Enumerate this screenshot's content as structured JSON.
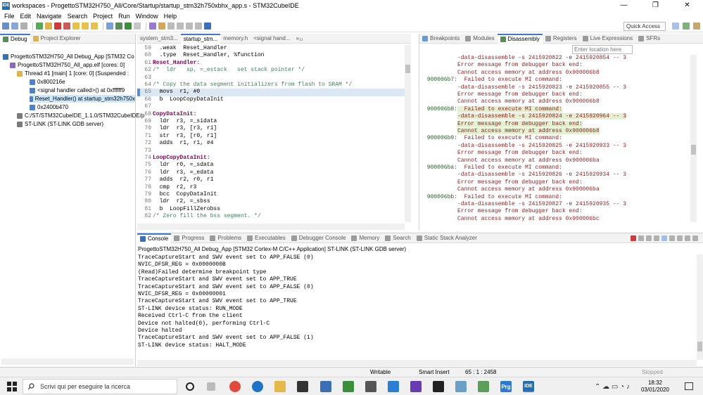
{
  "window": {
    "title": "workspaces - ProgettoSTM32H750_All/Core/Startup/startup_stm32h750xbhx_app.s - STM32CubeIDE",
    "app_icon": "IDE",
    "min": "—",
    "max": "❐",
    "close": "✕"
  },
  "menu": [
    "File",
    "Edit",
    "Navigate",
    "Search",
    "Project",
    "Run",
    "Window",
    "Help"
  ],
  "quick_access": "Quick Access",
  "left_tabs": [
    "Debug",
    "Project Explorer"
  ],
  "debug_tree": [
    "ProgettoSTM32H750_All Debug_App [STM32 Co",
    "ProgettoSTM32H750_All_app.elf [cores: 0]",
    "Thread #1 [main] 1 [core: 0] (Suspended :",
    "0x800216e",
    "<signal handler called>() at 0xffffff9",
    "Reset_Handler() at startup_stm32h750x",
    "0x2400b470",
    "C:/ST/STM32CubeIDE_1.1.0/STM32CubeIDE/p",
    "ST-LINK (ST-LINK GDB server)"
  ],
  "editor_tabs": [
    "system_stm3...",
    "startup_stm...",
    "memory.h",
    "<signal hand...",
    "»₂₁"
  ],
  "code": [
    {
      "n": "59",
      "t": "  .weak  Reset_Handler"
    },
    {
      "n": "60",
      "t": "  .type  Reset_Handler, %function"
    },
    {
      "n": "61",
      "t": "Reset_Handler:"
    },
    {
      "n": "62",
      "t": "/*  ldr   sp, =_estack   set stack pointer */"
    },
    {
      "n": "63",
      "t": ""
    },
    {
      "n": "64",
      "t": "/* Copy the data segment initializers from flash to SRAM */"
    },
    {
      "n": "65",
      "t": "  movs  r1, #0"
    },
    {
      "n": "66",
      "t": "  b  LoopCopyDataInit"
    },
    {
      "n": "67",
      "t": ""
    },
    {
      "n": "68",
      "t": "CopyDataInit:"
    },
    {
      "n": "69",
      "t": "  ldr  r3, =_sidata"
    },
    {
      "n": "70",
      "t": "  ldr  r3, [r3, r1]"
    },
    {
      "n": "71",
      "t": "  str  r3, [r0, r1]"
    },
    {
      "n": "72",
      "t": "  adds  r1, r1, #4"
    },
    {
      "n": "73",
      "t": ""
    },
    {
      "n": "74",
      "t": "LoopCopyDataInit:"
    },
    {
      "n": "75",
      "t": "  ldr  r0, =_sdata"
    },
    {
      "n": "76",
      "t": "  ldr  r3, =_edata"
    },
    {
      "n": "77",
      "t": "  adds  r2, r0, r1"
    },
    {
      "n": "78",
      "t": "  cmp  r2, r3"
    },
    {
      "n": "79",
      "t": "  bcc  CopyDataInit"
    },
    {
      "n": "80",
      "t": "  ldr  r2, =_sbss"
    },
    {
      "n": "81",
      "t": "  b  LoopFillZerobss"
    },
    {
      "n": "82",
      "t": "/* Zero fill the bss segment. */"
    }
  ],
  "right_tabs": [
    "Breakpoints",
    "Modules",
    "Disassembly",
    "Registers",
    "Live Expressions",
    "SFRs"
  ],
  "location_placeholder": "Enter location here",
  "disasm": [
    {
      "a": "",
      "t": "-data-disassemble -s 2415920822 -e 2415920854 -- 3"
    },
    {
      "a": "",
      "t": "Error message from debugger back end:"
    },
    {
      "a": "",
      "t": "Cannot access memory at address 0x900006b8"
    },
    {
      "a": "900006b7:",
      "t": "  Failed to execute MI command:"
    },
    {
      "a": "",
      "t": "-data-disassemble -s 2415920823 -e 2415920855 -- 3"
    },
    {
      "a": "",
      "t": "Error message from debugger back end:"
    },
    {
      "a": "",
      "t": "Cannot access memory at address 0x900006b8"
    },
    {
      "a": "900006b8:",
      "t": "  Failed to execute MI command:"
    },
    {
      "a": "",
      "t": "-data-disassemble -s 2415920824 -e 2415920964 -- 3"
    },
    {
      "a": "",
      "t": "Error message from debugger back end:"
    },
    {
      "a": "",
      "t": "Cannot access memory at address 0x900006b8"
    },
    {
      "a": "900006b9:",
      "t": "  Failed to execute MI command:"
    },
    {
      "a": "",
      "t": "-data-disassemble -s 2415920825 -e 2415920933 -- 3"
    },
    {
      "a": "",
      "t": "Error message from debugger back end:"
    },
    {
      "a": "",
      "t": "Cannot access memory at address 0x900006ba"
    },
    {
      "a": "900006ba:",
      "t": "  Failed to execute MI command:"
    },
    {
      "a": "",
      "t": "-data-disassemble -s 2415920826 -e 2415920934 -- 3"
    },
    {
      "a": "",
      "t": "Error message from debugger back end:"
    },
    {
      "a": "",
      "t": "Cannot access memory at address 0x900006ba"
    },
    {
      "a": "900006bb:",
      "t": "  Failed to execute MI command:"
    },
    {
      "a": "",
      "t": "-data-disassemble -s 2415920827 -e 2415920935 -- 3"
    },
    {
      "a": "",
      "t": "Error message from debugger back end:"
    },
    {
      "a": "",
      "t": "Cannot access memory at address 0x900006bc"
    }
  ],
  "console_tabs": [
    "Console",
    "Progress",
    "Problems",
    "Executables",
    "Debugger Console",
    "Memory",
    "Search",
    "Static Stack Analyzer"
  ],
  "console_header": "ProgettoSTM32H750_All Debug_App [STM32 Cortex-M C/C++ Application] ST-LINK (ST-LINK GDB server)",
  "console_lines": [
    "TraceCaptureStart and SWV event set to APP_FALSE (0)",
    "NVIC_DFSR_REG = 0x0000000B",
    "(Read)Failed determine breakpoint type",
    "TraceCaptureStart and SWV event set to APP_TRUE",
    "TraceCaptureStart and SWV event set to APP_FALSE (0)",
    "NVIC_DFSR_REG = 0x00000001",
    "TraceCaptureStart and SWV event set to APP_TRUE",
    "ST-LINK device status: RUN_MODE",
    "Received Ctrl-C from the client",
    "Device not halted(0), performing Ctrl-C",
    "Device halted",
    "TraceCaptureStart and SWV event set to APP_FALSE (1)",
    "ST-LINK device status: HALT_MODE"
  ],
  "status": {
    "writable": "Writable",
    "insert": "Smart Insert",
    "pos": "65 : 1 : 2458",
    "stopped": "Stopped"
  },
  "taskbar": {
    "search": "Scrivi qui per eseguire la ricerca",
    "time": "18:32",
    "date": "03/01/2020",
    "prg": "Prg",
    "ide": "IDE"
  }
}
